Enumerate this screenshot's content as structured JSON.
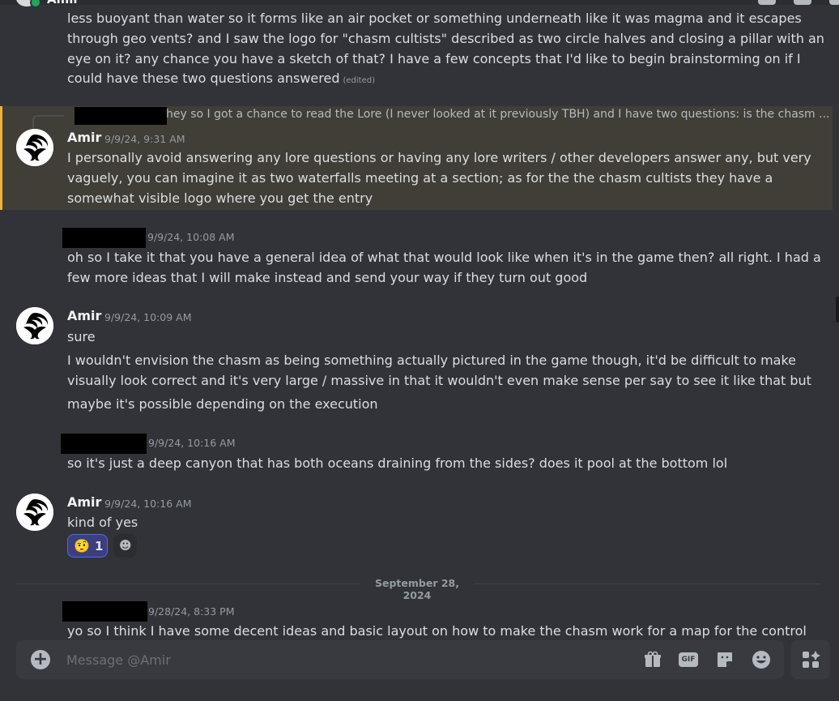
{
  "window": {
    "recipient": "Amir"
  },
  "messages": {
    "partial": {
      "line1": "less buoyant than water so it forms like an air pocket or something underneath like it was magma and it escapes",
      "line2": "through geo vents? and I saw the logo for \"chasm cultists\" described as two circle halves and closing a pillar with an",
      "line3": "eye on it? any chance you have a sketch of that? I have a few concepts that I'd like to begin brainstorming on if I",
      "line4": "could have these two questions answered",
      "edited": "(edited)"
    },
    "amir1": {
      "reply_preview": "hey so I got a chance to read the Lore (I never looked at it previously TBH) and I have two questions: is the chasm ...",
      "author": "Amir",
      "timestamp": "9/9/24, 9:31 AM",
      "line1": "I personally avoid answering any lore questions or having any lore writers / other developers answer any, but very",
      "line2": "vaguely, you can imagine it as two waterfalls meeting at a section; as for the the chasm cultists they have a",
      "line3": "somewhat visible logo where you get the entry"
    },
    "user1": {
      "timestamp": "9/9/24, 10:08 AM",
      "line1": "oh so I take it that you have a general idea of what that would look like when it's in the game then? all right. I had a",
      "line2": "few more ideas that I will make instead and send your way if they turn out good"
    },
    "amir2": {
      "author": "Amir",
      "timestamp": "9/9/24, 10:09 AM",
      "line1": "sure",
      "line2": "I wouldn't envision the chasm as being something actually pictured in the game though, it'd be difficult to make",
      "line3": "visually look correct and it's very large / massive in that it wouldn't even make sense per say to see it like that but",
      "line4": "maybe it's possible depending on the execution"
    },
    "user2": {
      "timestamp": "9/9/24, 10:16 AM",
      "line1": "so it's just a deep canyon that has both oceans draining from the sides? does it pool at the bottom lol"
    },
    "amir3": {
      "author": "Amir",
      "timestamp": "9/9/24, 10:16 AM",
      "line1": "kind of yes",
      "reaction": {
        "emoji": "🤨",
        "count": "1"
      }
    },
    "date_divider": "September 28, 2024",
    "user3": {
      "timestamp": "9/28/24, 8:33 PM",
      "line1": "yo so I think I have some decent ideas and basic layout on how to make the chasm work for a map for the control"
    }
  },
  "composer": {
    "placeholder": "Message @Amir"
  },
  "colors": {
    "background": "#313338",
    "highlight": "#403e37",
    "highlight_border": "#f0b232",
    "reaction_bg": "#3b3f7e",
    "reaction_border": "#5865f2"
  }
}
